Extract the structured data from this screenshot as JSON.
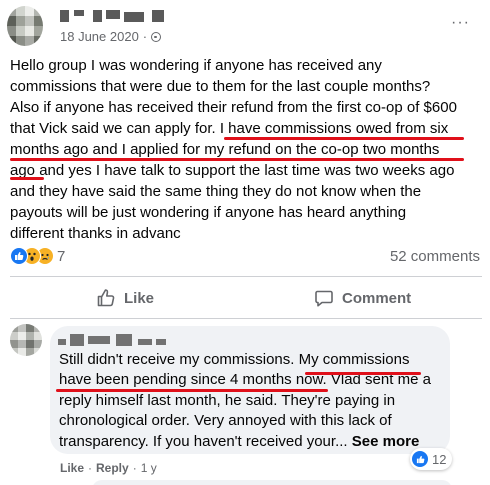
{
  "post": {
    "date": "18 June 2020",
    "separator": "·",
    "privacy_icon": "globe-icon",
    "more_icon": "more-options-icon",
    "more_label": "···",
    "text": "Hello group I was wondering if anyone has received any\ncommissions that were due to them for the last couple months?\nAlso if anyone has received their refund from the first co-op of $600\nthat Vick said we can apply for.  I have commissions owed from six\nmonths ago and I applied for my refund on the co-op two months\nago and yes I have talk to support the last time was two weeks ago\nand they have said the same thing they do not know when the\npayouts will be just wondering if anyone has heard anything\ndifferent thanks in advanc",
    "reactions": [
      "like",
      "wow",
      "sad"
    ],
    "reaction_count": "7",
    "comment_count": "52 comments"
  },
  "actions": {
    "like_label": "Like",
    "comment_label": "Comment"
  },
  "comment": {
    "text": "Still didn't receive my commissions. My commissions\nhave been pending since 4 months now. Vlad sent me a\nreply himself last month, he said. They're paying in\nchronological order. Very annoyed with this lack of\ntransparency. If you haven't received your...",
    "see_more": "See more",
    "like_link": "Like",
    "reply_link": "Reply",
    "dot": "·",
    "age": "1 y",
    "reaction_count": "12"
  },
  "colors": {
    "accent": "#1877f2",
    "underline": "#e0101a",
    "secondary_text": "#65676b",
    "bubble": "#f0f2f5"
  }
}
